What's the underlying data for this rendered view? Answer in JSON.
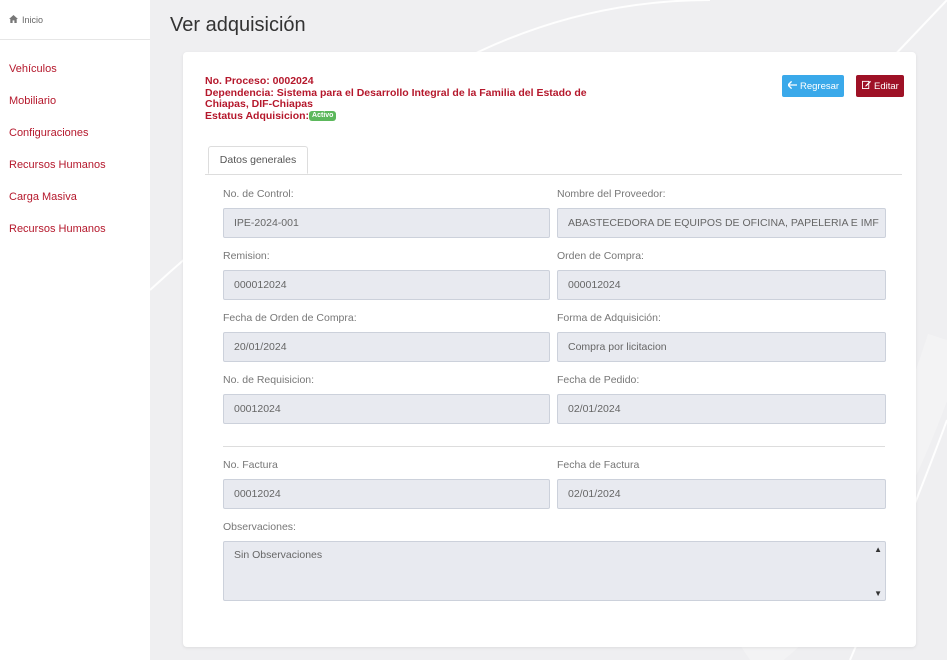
{
  "sidebar": {
    "home_label": "Inicio",
    "home_icon": "home-icon",
    "items": [
      {
        "label": "Vehículos"
      },
      {
        "label": "Mobiliario"
      },
      {
        "label": "Configuraciones"
      },
      {
        "label": "Recursos Humanos"
      },
      {
        "label": "Carga Masiva"
      },
      {
        "label": "Recursos Humanos"
      }
    ]
  },
  "page": {
    "title": "Ver adquisición"
  },
  "header": {
    "proceso": "No. Proceso: 0002024",
    "dependencia_line1": "Dependencia: Sistema para el Desarrollo Integral de la Familia del Estado de",
    "dependencia_line2": "Chiapas, DIF-Chiapas",
    "estatus_label": "Estatus Adquisicion:",
    "estatus_badge": "Activo"
  },
  "buttons": {
    "back_label": "Regresar",
    "back_icon": "arrow-left-icon",
    "edit_label": "Editar",
    "edit_icon": "edit-icon"
  },
  "tabs": [
    {
      "label": "Datos generales",
      "active": true
    }
  ],
  "fields": {
    "no_control": {
      "label": "No. de Control:",
      "value": "IPE-2024-001"
    },
    "proveedor": {
      "label": "Nombre del Proveedor:",
      "value": "ABASTECEDORA DE EQUIPOS DE OFICINA, PAPELERIA E IMF"
    },
    "remision": {
      "label": "Remision:",
      "value": "000012024"
    },
    "orden_compra": {
      "label": "Orden de Compra:",
      "value": "000012024"
    },
    "fecha_orden": {
      "label": "Fecha de Orden de Compra:",
      "value": "20/01/2024"
    },
    "forma_adq": {
      "label": "Forma de Adquisición:",
      "value": "Compra por licitacion"
    },
    "no_requisicion": {
      "label": "No. de Requisicion:",
      "value": "00012024"
    },
    "fecha_pedido": {
      "label": "Fecha de Pedido:",
      "value": "02/01/2024"
    },
    "no_factura": {
      "label": "No. Factura",
      "value": "00012024"
    },
    "fecha_factura": {
      "label": "Fecha de Factura",
      "value": "02/01/2024"
    },
    "observaciones": {
      "label": "Observaciones:",
      "value": "Sin Observaciones"
    }
  },
  "colors": {
    "accent_red": "#b5182c",
    "edit_button": "#9e1126",
    "back_button": "#3aa9ea",
    "badge_green": "#5cb85c"
  }
}
